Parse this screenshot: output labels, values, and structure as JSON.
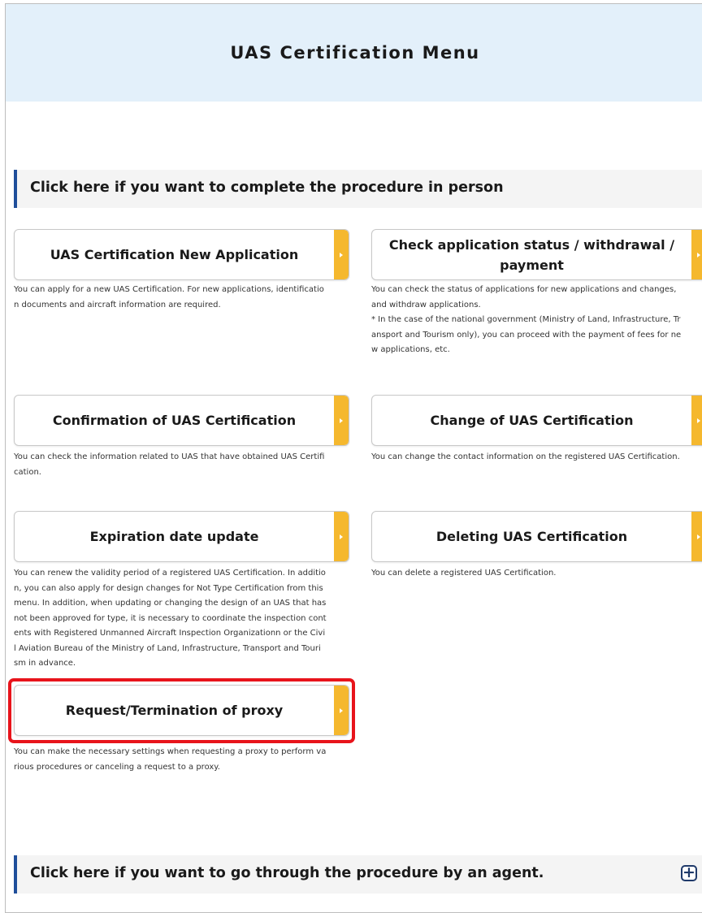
{
  "page": {
    "title": "UAS Certification Menu"
  },
  "sections": {
    "in_person": "Click here if you want to complete the procedure in person",
    "agent": "Click here if you want to go through the procedure by an agent."
  },
  "menu": {
    "new_application": {
      "label": "UAS Certification New Application",
      "desc": "You can apply for a new UAS Certification. For new applications, identificatio\nn documents and aircraft information are required."
    },
    "check_status": {
      "label": "Check application status / withdrawal /\npayment",
      "desc": "You can check the status of applications for new applications and changes,\nand withdraw applications.\n* In the case of the national government (Ministry of Land, Infrastructure, Tr\nansport and Tourism only), you can proceed with the payment of fees for ne\nw applications, etc."
    },
    "confirmation": {
      "label": "Confirmation of UAS Certification",
      "desc": "You can check the information related to UAS that have obtained UAS Certifi\ncation."
    },
    "change": {
      "label": "Change of UAS Certification",
      "desc": "You can change the contact information on the registered UAS Certification."
    },
    "expiration": {
      "label": "Expiration date update",
      "desc": "You can renew the validity period of a registered UAS Certification. In additio\nn, you can also apply for design changes for Not Type Certification from this\nmenu. In addition, when updating or changing the design of an UAS that has\nnot been approved for type, it is necessary to coordinate the inspection cont\nents with Registered Unmanned Aircraft Inspection Organizationn or the Civi\nl Aviation Bureau of the Ministry of Land, Infrastructure, Transport and Touri\nsm in advance."
    },
    "deleting": {
      "label": "Deleting UAS Certification",
      "desc": "You can delete a registered UAS Certification."
    },
    "proxy": {
      "label": "Request/Termination of proxy",
      "desc": "You can make the necessary settings when requesting a proxy to perform va\nrious procedures or canceling a request to a proxy."
    }
  },
  "icons": {
    "expand": "plus-icon",
    "arrow": "arrow-right-icon"
  },
  "colors": {
    "header_bg": "#e3f0fa",
    "section_accent": "#1f4e9a",
    "button_arrow": "#f5b82e",
    "highlight": "#e8141b"
  }
}
